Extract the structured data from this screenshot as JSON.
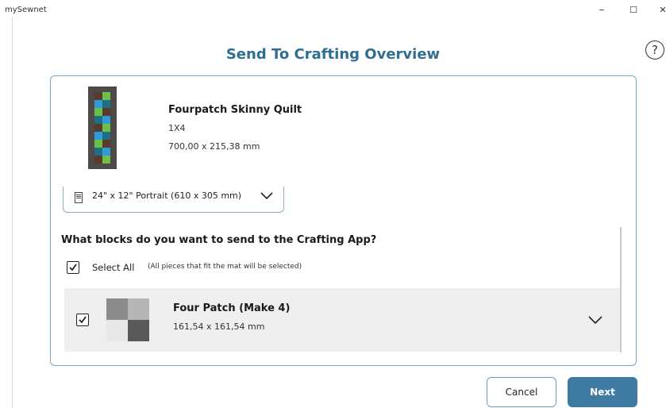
{
  "window": {
    "app_title": "mySewnet",
    "minimize_icon": "–",
    "maximize_icon": "☐",
    "close_icon": "✕"
  },
  "help": {
    "icon": "?"
  },
  "page": {
    "title": "Send To Crafting Overview"
  },
  "quilt": {
    "name": "Fourpatch Skinny Quilt",
    "layout": "1X4",
    "size": "700,00 x 215,38 mm",
    "thumbnail_colors": [
      "#2f9ad4",
      "#6cc04a",
      "#1f6e82",
      "#5b3a2e",
      "#4d4a47"
    ]
  },
  "mat": {
    "selected": "24\" x 12\" Portrait (610 x 305 mm)",
    "icon": "mat-icon"
  },
  "blocks": {
    "question": "What blocks do you want to send to the Crafting App?",
    "select_all_label": "Select All",
    "select_all_checked": true,
    "select_all_note": "(All pieces that fit the mat will be selected)",
    "items": [
      {
        "name": "Four Patch (Make 4)",
        "size": "161,54 x 161,54 mm",
        "checked": true,
        "thumbnail_colors": [
          "#8c8c8c",
          "#b5b5b5",
          "#e8e8e8",
          "#595959"
        ]
      }
    ]
  },
  "buttons": {
    "cancel": "Cancel",
    "next": "Next"
  },
  "colors": {
    "accent": "#2f6e93",
    "primary_button": "#3f7aa3",
    "panel_border": "#7ea3bd"
  }
}
